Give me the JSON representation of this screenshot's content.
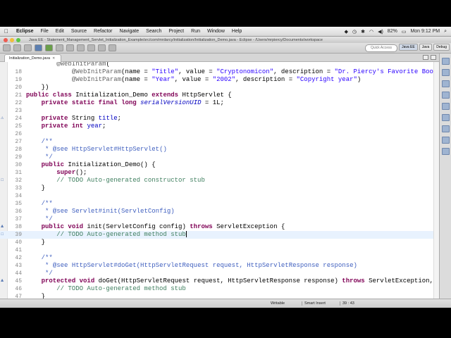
{
  "menubar": {
    "app": "Eclipse",
    "items": [
      "File",
      "Edit",
      "Source",
      "Refactor",
      "Navigate",
      "Search",
      "Project",
      "Run",
      "Window",
      "Help"
    ],
    "battery": "82%",
    "clock": "Mon 9:12 PM"
  },
  "window": {
    "title": "Java EE - Statement_Management_Servlet_Initialization_Example/src/com/mrdarcy/initialization/Initialization_Demo.java - Eclipse - /Users/mrpiercy/Documents/workspace"
  },
  "toolbar": {
    "quick_access": "Quick Access",
    "perspectives": [
      "Java EE",
      "Java",
      "Debug"
    ]
  },
  "editor": {
    "tab_label": "Initialization_Demo.java",
    "tab_close": "✕",
    "lines": [
      {
        "n": "",
        "text": "        @WebInitParam("
      },
      {
        "n": "18",
        "text": "            @WebInitParam(name = \"Title\", value = \"Cryptonomicon\", description = \"Dr. Piercy's Favorite Book\"),"
      },
      {
        "n": "19",
        "text": "            @WebInitParam(name = \"Year\", value = \"2002\", description = \"Copyright year\")"
      },
      {
        "n": "20",
        "text": "    })"
      },
      {
        "n": "21",
        "text": "public class Initialization_Demo extends HttpServlet {"
      },
      {
        "n": "22",
        "text": "    private static final long serialVersionUID = 1L;"
      },
      {
        "n": "23",
        "text": ""
      },
      {
        "n": "24",
        "text": "    private String title;"
      },
      {
        "n": "25",
        "text": "    private int year;"
      },
      {
        "n": "26",
        "text": ""
      },
      {
        "n": "27",
        "text": "    /**"
      },
      {
        "n": "28",
        "text": "     * @see HttpServlet#HttpServlet()"
      },
      {
        "n": "29",
        "text": "     */"
      },
      {
        "n": "30",
        "text": "    public Initialization_Demo() {"
      },
      {
        "n": "31",
        "text": "        super();"
      },
      {
        "n": "32",
        "text": "        // TODO Auto-generated constructor stub"
      },
      {
        "n": "33",
        "text": "    }"
      },
      {
        "n": "34",
        "text": ""
      },
      {
        "n": "35",
        "text": "    /**"
      },
      {
        "n": "36",
        "text": "     * @see Servlet#init(ServletConfig)"
      },
      {
        "n": "37",
        "text": "     */"
      },
      {
        "n": "38",
        "text": "    public void init(ServletConfig config) throws ServletException {"
      },
      {
        "n": "39",
        "text": "        // TODO Auto-generated method stub"
      },
      {
        "n": "40",
        "text": "    }"
      },
      {
        "n": "41",
        "text": ""
      },
      {
        "n": "42",
        "text": "    /**"
      },
      {
        "n": "43",
        "text": "     * @see HttpServlet#doGet(HttpServletRequest request, HttpServletResponse response)"
      },
      {
        "n": "44",
        "text": "     */"
      },
      {
        "n": "45",
        "text": "    protected void doGet(HttpServletRequest request, HttpServletResponse response) throws ServletException, IOException {"
      },
      {
        "n": "46",
        "text": "        // TODO Auto-generated method stub"
      },
      {
        "n": "47",
        "text": "    }"
      }
    ]
  },
  "statusbar": {
    "writable": "Writable",
    "insert_mode": "Smart Insert",
    "position": "39 : 43"
  }
}
